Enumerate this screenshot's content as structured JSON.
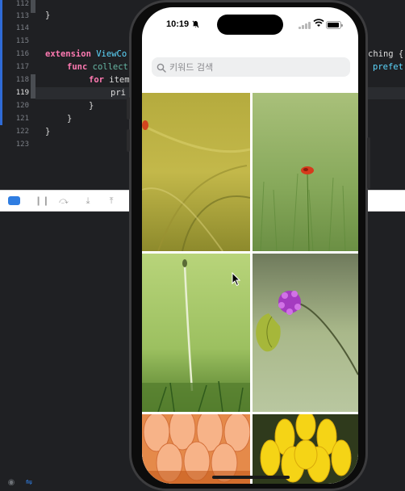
{
  "editor": {
    "lines": [
      {
        "num": "112",
        "text": ""
      },
      {
        "num": "113",
        "text": "}"
      },
      {
        "num": "114",
        "text": ""
      },
      {
        "num": "115",
        "text": ""
      },
      {
        "num": "116",
        "text": "extension ViewCo"
      },
      {
        "num": "117",
        "text": "func collect"
      },
      {
        "num": "118",
        "text": "for item"
      },
      {
        "num": "119",
        "text": "pri"
      },
      {
        "num": "120",
        "text": "}"
      },
      {
        "num": "121",
        "text": "}"
      },
      {
        "num": "122",
        "text": "}"
      },
      {
        "num": "123",
        "text": ""
      }
    ],
    "right_fragments": {
      "line116": "ching {",
      "line117": "prefet"
    }
  },
  "phone": {
    "status": {
      "time": "10:19",
      "bell_icon": "bell-slash-icon",
      "wifi_icon": "wifi-icon",
      "battery_icon": "battery-icon"
    },
    "search": {
      "placeholder": "키워드 검색",
      "icon": "magnifying-glass-icon"
    },
    "photos": [
      {
        "name": "yellow-grass-poppy-photo"
      },
      {
        "name": "green-field-poppy-photo"
      },
      {
        "name": "dandelion-stem-photo"
      },
      {
        "name": "purple-flower-butterfly-photo"
      },
      {
        "name": "orange-petals-photo"
      },
      {
        "name": "yellow-dahlia-photo"
      }
    ]
  },
  "colors": {
    "editor_bg": "#1f2023",
    "keyword": "#ff7ab2",
    "type": "#5dd8ff",
    "accent": "#2f6bd6"
  }
}
